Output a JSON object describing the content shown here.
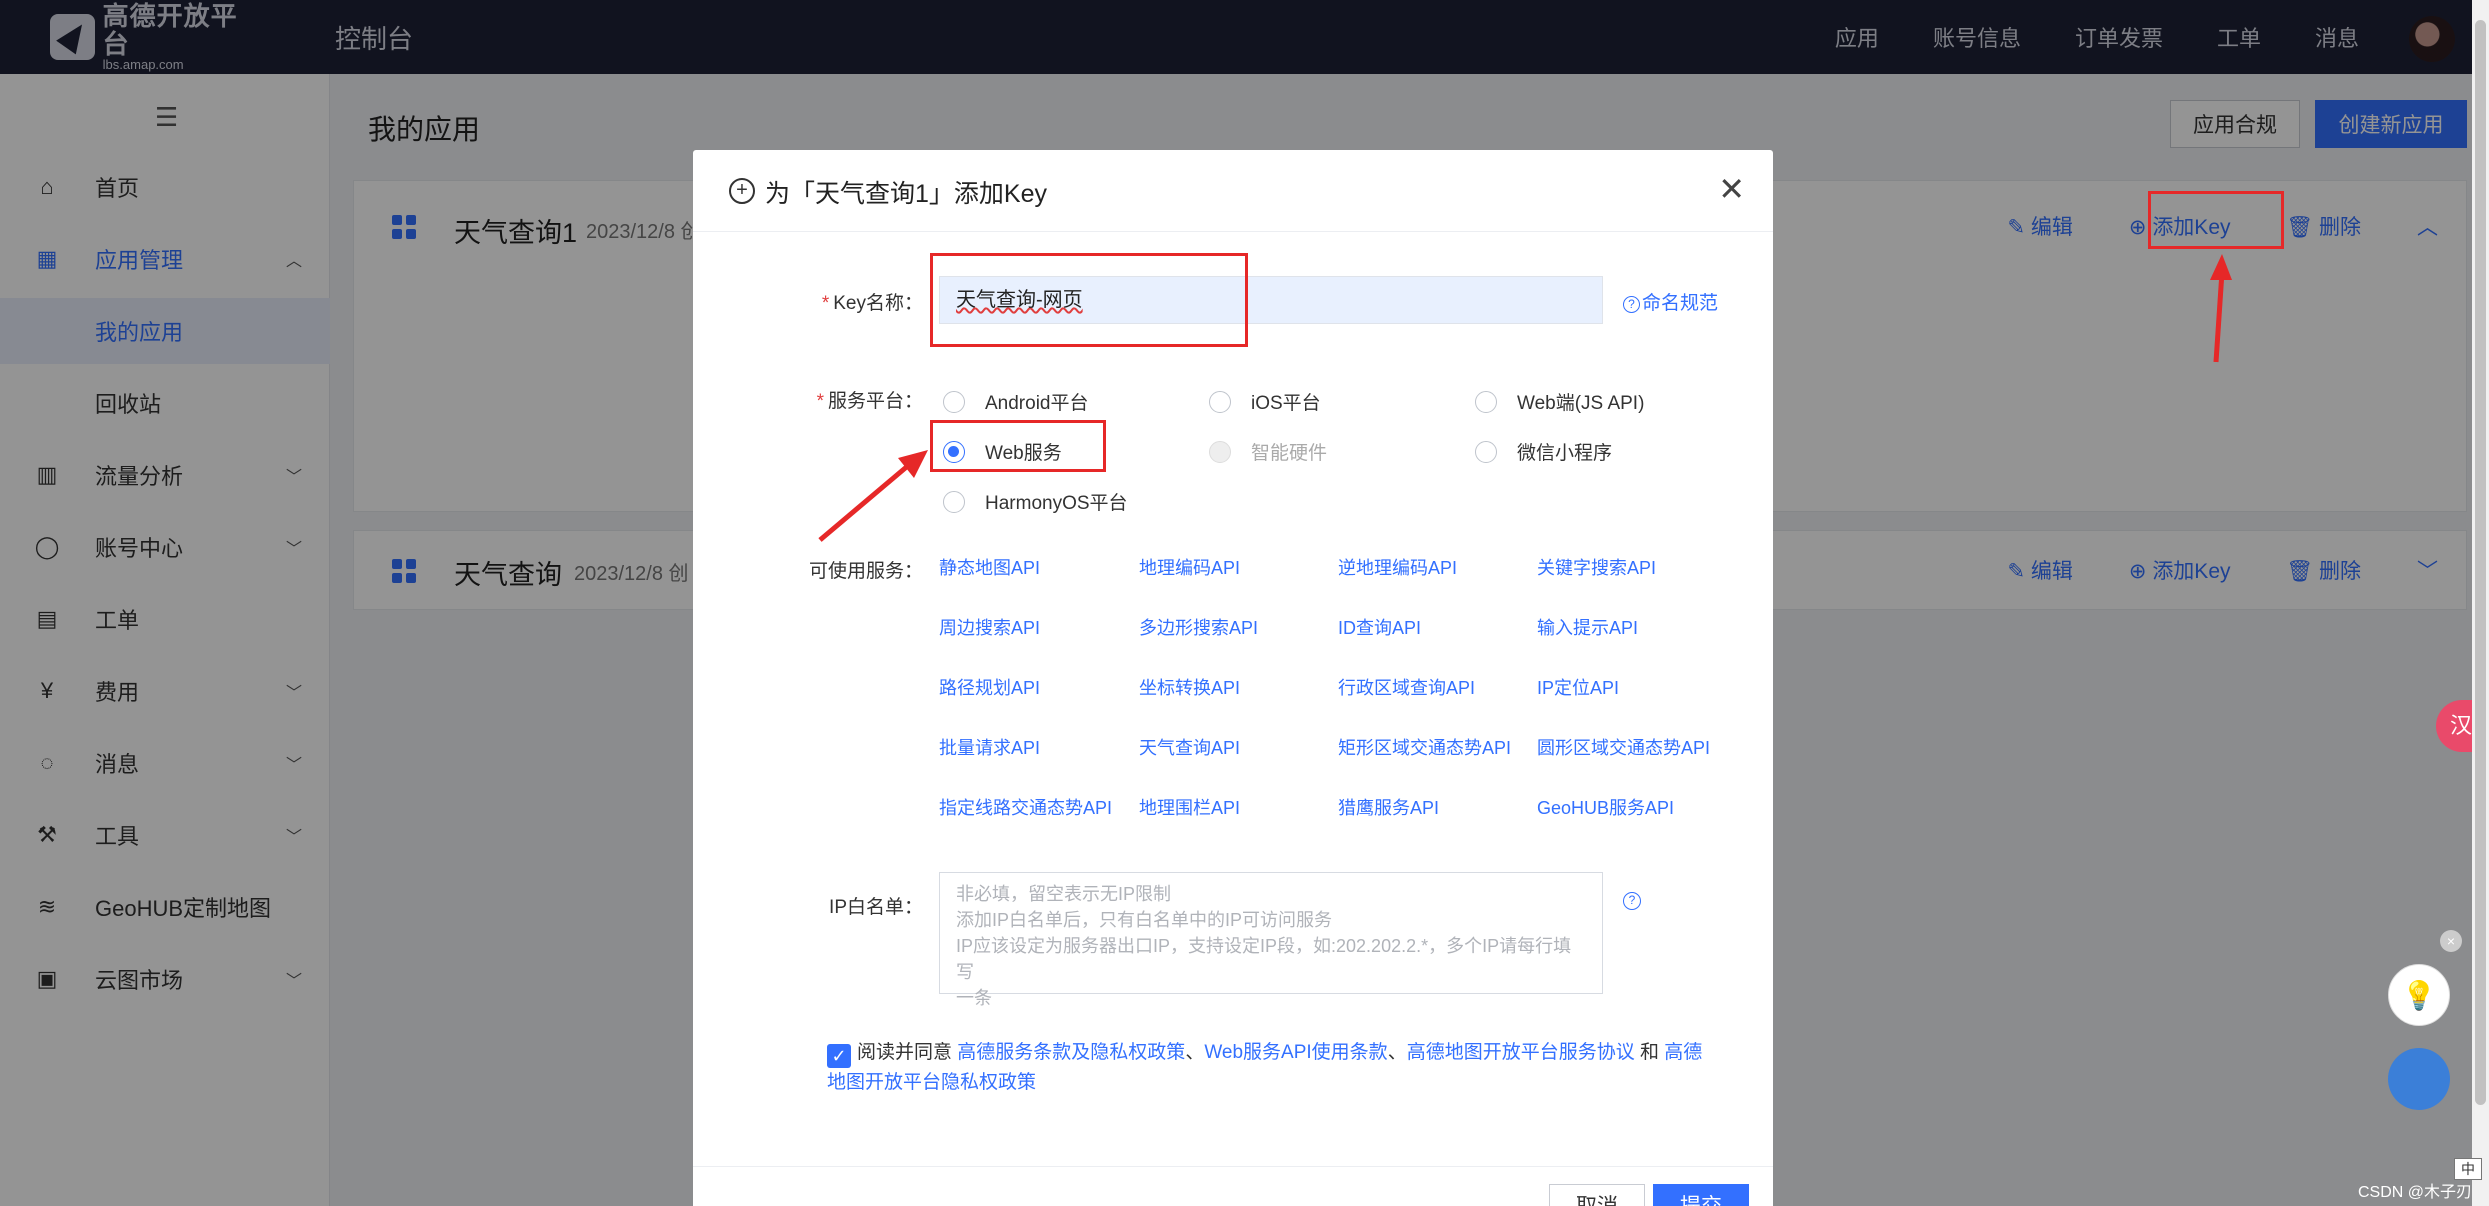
{
  "topbar": {
    "logo_cn": "高德开放平台",
    "logo_en": "lbs.amap.com",
    "console": "控制台",
    "nav": [
      "应用",
      "账号信息",
      "订单发票",
      "工单",
      "消息"
    ]
  },
  "sidebar": {
    "items": [
      {
        "label": "首页",
        "icon": "home-icon"
      },
      {
        "label": "应用管理",
        "icon": "grid-icon"
      },
      {
        "label": "我的应用",
        "icon": ""
      },
      {
        "label": "回收站",
        "icon": ""
      },
      {
        "label": "流量分析",
        "icon": "chart-icon"
      },
      {
        "label": "账号中心",
        "icon": "user-icon"
      },
      {
        "label": "工单",
        "icon": "ticket-icon"
      },
      {
        "label": "费用",
        "icon": "yen-icon"
      },
      {
        "label": "消息",
        "icon": "message-icon"
      },
      {
        "label": "工具",
        "icon": "wrench-icon"
      },
      {
        "label": "GeoHUB定制地图",
        "icon": "layers-icon"
      },
      {
        "label": "云图市场",
        "icon": "store-icon"
      }
    ]
  },
  "main": {
    "title": "我的应用",
    "compliance_button": "应用合规",
    "create_button": "创建新应用",
    "cards": [
      {
        "title": "天气查询1",
        "date": "2023/12/8 创",
        "edit": "编辑",
        "add_key": "添加Key",
        "delete": "删除"
      },
      {
        "title": "天气查询",
        "date": "2023/12/8 创",
        "edit": "编辑",
        "add_key": "添加Key",
        "delete": "删除"
      }
    ]
  },
  "modal": {
    "title": "为「天气查询1」添加Key",
    "key_name_label": "Key名称：",
    "key_name_value": "天气查询-网页",
    "naming_rule": "命名规范",
    "platform_label": "服务平台：",
    "platforms": [
      {
        "label": "Android平台",
        "checked": false,
        "disabled": false
      },
      {
        "label": "iOS平台",
        "checked": false,
        "disabled": false
      },
      {
        "label": "Web端(JS API)",
        "checked": false,
        "disabled": false
      },
      {
        "label": "Web服务",
        "checked": true,
        "disabled": false
      },
      {
        "label": "智能硬件",
        "checked": false,
        "disabled": true
      },
      {
        "label": "微信小程序",
        "checked": false,
        "disabled": false
      },
      {
        "label": "HarmonyOS平台",
        "checked": false,
        "disabled": false
      }
    ],
    "services_label": "可使用服务：",
    "services": [
      "静态地图API",
      "地理编码API",
      "逆地理编码API",
      "关键字搜索API",
      "周边搜索API",
      "多边形搜索API",
      "ID查询API",
      "输入提示API",
      "路径规划API",
      "坐标转换API",
      "行政区域查询API",
      "IP定位API",
      "批量请求API",
      "天气查询API",
      "矩形区域交通态势API",
      "圆形区域交通态势API",
      "指定线路交通态势API",
      "地理围栏API",
      "猎鹰服务API",
      "GeoHUB服务API"
    ],
    "ip_label": "IP白名单：",
    "ip_placeholder_lines": [
      "非必填，留空表示无IP限制",
      "添加IP白名单后，只有白名单中的IP可访问服务",
      "IP应该设定为服务器出口IP，支持设定IP段，如:202.202.2.*，多个IP请每行填写",
      "一条"
    ],
    "agree_prefix": "阅读并同意",
    "agree_link1": "高德服务条款及隐私权政策",
    "sep1": "、",
    "agree_link2": "Web服务API使用条款",
    "sep2": "、",
    "agree_link3": "高德地图开放平台服务协议",
    "and": " 和 ",
    "agree_link4": "高德地图开放平台隐私权政策",
    "cancel": "取消",
    "submit": "提交"
  },
  "misc": {
    "translate_badge": "汉A",
    "watermark": "CSDN @木子刃",
    "ime": "中"
  },
  "colors": {
    "accent": "#3370ff",
    "annotation": "#e62828",
    "topbar": "#1e2236"
  }
}
